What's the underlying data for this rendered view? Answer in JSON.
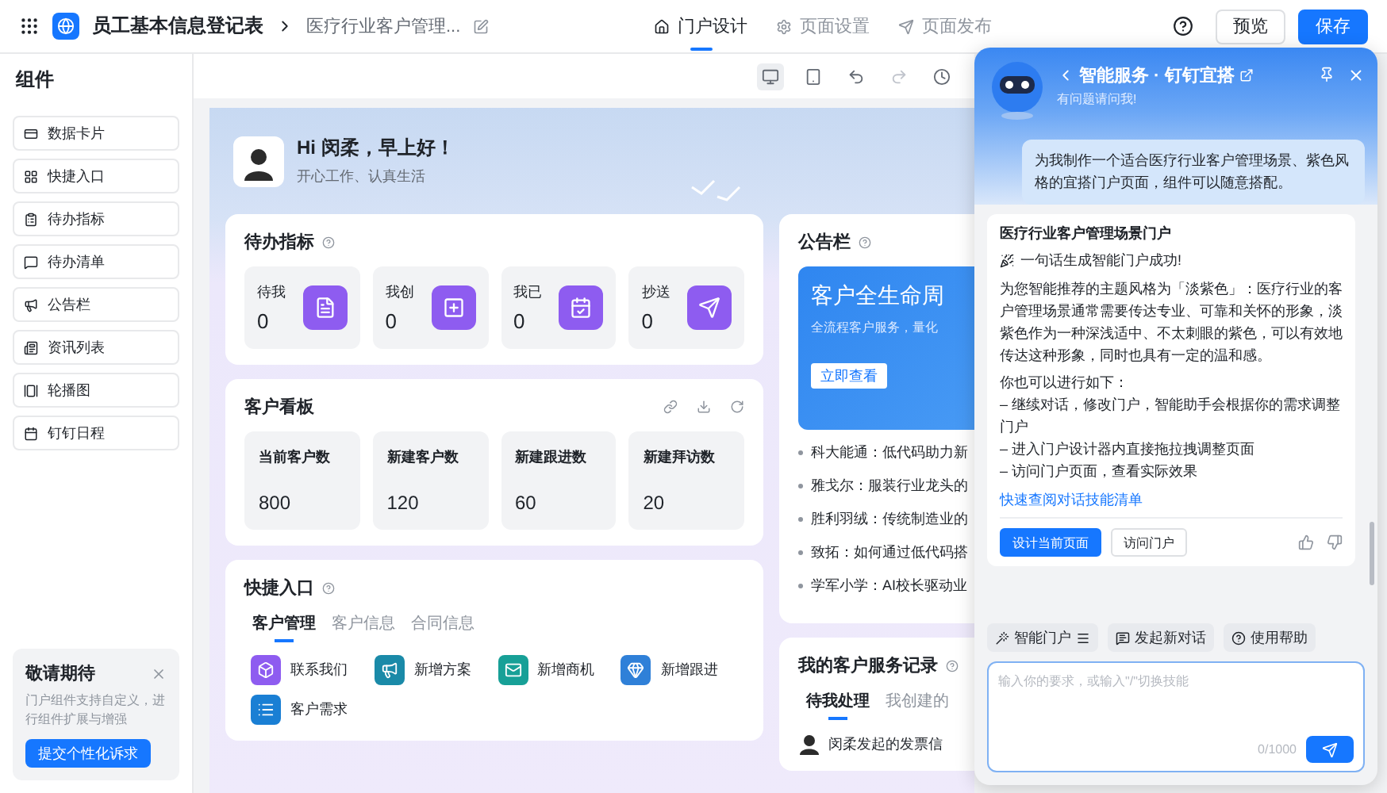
{
  "topbar": {
    "app_name": "员工基本信息登记表",
    "page_name": "医疗行业客户管理...",
    "tabs": [
      {
        "label": "门户设计",
        "kind": "home",
        "selected": true
      },
      {
        "label": "页面设置",
        "kind": "settings",
        "selected": false
      },
      {
        "label": "页面发布",
        "kind": "publish",
        "selected": false
      }
    ],
    "buttons": [
      {
        "label": "预览",
        "kind": "secondary"
      },
      {
        "label": "保存",
        "kind": "primary"
      }
    ]
  },
  "sidebar": {
    "title": "组件",
    "items": [
      {
        "label": "数据卡片",
        "kind": "card"
      },
      {
        "label": "快捷入口",
        "kind": "grid"
      },
      {
        "label": "待办指标",
        "kind": "todo"
      },
      {
        "label": "待办清单",
        "kind": "list"
      },
      {
        "label": "公告栏",
        "kind": "notice"
      },
      {
        "label": "资讯列表",
        "kind": "news"
      },
      {
        "label": "轮播图",
        "kind": "carousel"
      },
      {
        "label": "钉钉日程",
        "kind": "calendar"
      }
    ],
    "promo": {
      "title": "敬请期待",
      "text": "门户组件支持自定义，进行组件扩展与增强",
      "button": "提交个性化诉求"
    }
  },
  "hero": {
    "greeting": "Hi 闵柔，早上好！",
    "subtitle": "开心工作、认真生活"
  },
  "todo": {
    "title": "待办指标",
    "items": [
      {
        "label": "待我",
        "value": "0",
        "kind": "doc"
      },
      {
        "label": "我创",
        "value": "0",
        "kind": "add"
      },
      {
        "label": "我已",
        "value": "0",
        "kind": "done"
      },
      {
        "label": "抄送",
        "value": "0",
        "kind": "send"
      }
    ]
  },
  "board": {
    "title": "客户看板",
    "metrics": [
      {
        "label": "当前客户数",
        "value": "800"
      },
      {
        "label": "新建客户数",
        "value": "120"
      },
      {
        "label": "新建跟进数",
        "value": "60"
      },
      {
        "label": "新建拜访数",
        "value": "20"
      }
    ]
  },
  "quick": {
    "title": "快捷入口",
    "tabs": [
      {
        "label": "客户管理",
        "selected": true
      },
      {
        "label": "客户信息",
        "selected": false
      },
      {
        "label": "合同信息",
        "selected": false
      }
    ],
    "entries": [
      {
        "label": "联系我们",
        "kind": "box",
        "color": "#8e5cf0"
      },
      {
        "label": "新增方案",
        "kind": "megaphone",
        "color": "#1a8aa8"
      },
      {
        "label": "新增商机",
        "kind": "mail",
        "color": "#17a097"
      },
      {
        "label": "新增跟进",
        "kind": "gem",
        "color": "#2f80d8"
      },
      {
        "label": "客户需求",
        "kind": "list",
        "color": "#1a7fd4"
      }
    ]
  },
  "notice": {
    "title": "公告栏",
    "banner": {
      "title": "客户全生命周",
      "subtitle": "全流程客户服务，量化",
      "button": "立即查看"
    },
    "news": [
      "科大能通：低代码助力新",
      "雅戈尔：服装行业龙头的",
      "胜利羽绒：传统制造业的",
      "致拓：如何通过低代码搭",
      "学军小学：AI校长驱动业"
    ]
  },
  "records": {
    "title": "我的客户服务记录",
    "tabs": [
      {
        "label": "待我处理",
        "selected": true
      },
      {
        "label": "我创建的",
        "selected": false
      }
    ],
    "items": [
      "闵柔发起的发票信"
    ]
  },
  "assistant": {
    "title": "智能服务 · 钉钉宜搭",
    "subtitle": "有问题请问我!",
    "user_message": "为我制作一个适合医疗行业客户管理场景、紫色风格的宜搭门户页面，组件可以随意搭配。",
    "answer": {
      "title": "医疗行业客户管理场景门户",
      "success": "一句话生成智能门户成功!",
      "paragraph": "为您智能推荐的主题风格为「淡紫色」：医疗行业的客户管理场景通常需要传达专业、可靠和关怀的形象，淡紫色作为一种深浅适中、不太刺眼的紫色，可以有效地传达这种形象，同时也具有一定的温和感。",
      "intro": "你也可以进行如下：",
      "steps": [
        "– 继续对话，修改门户，智能助手会根据你的需求调整门户",
        "– 进入门户设计器内直接拖拉拽调整页面",
        "– 访问门户页面，查看实际效果"
      ],
      "link": "快速查阅对话技能清单",
      "buttons": [
        {
          "label": "设计当前页面",
          "kind": "primary"
        },
        {
          "label": "访问门户",
          "kind": "secondary"
        }
      ]
    },
    "chips": [
      {
        "label": "智能门户",
        "kind": "portal"
      },
      {
        "label": "发起新对话",
        "kind": "chat"
      },
      {
        "label": "使用帮助",
        "kind": "help"
      }
    ],
    "input": {
      "placeholder": "输入你的要求，或输入\"/\"切换技能",
      "counter": "0/1000"
    }
  }
}
